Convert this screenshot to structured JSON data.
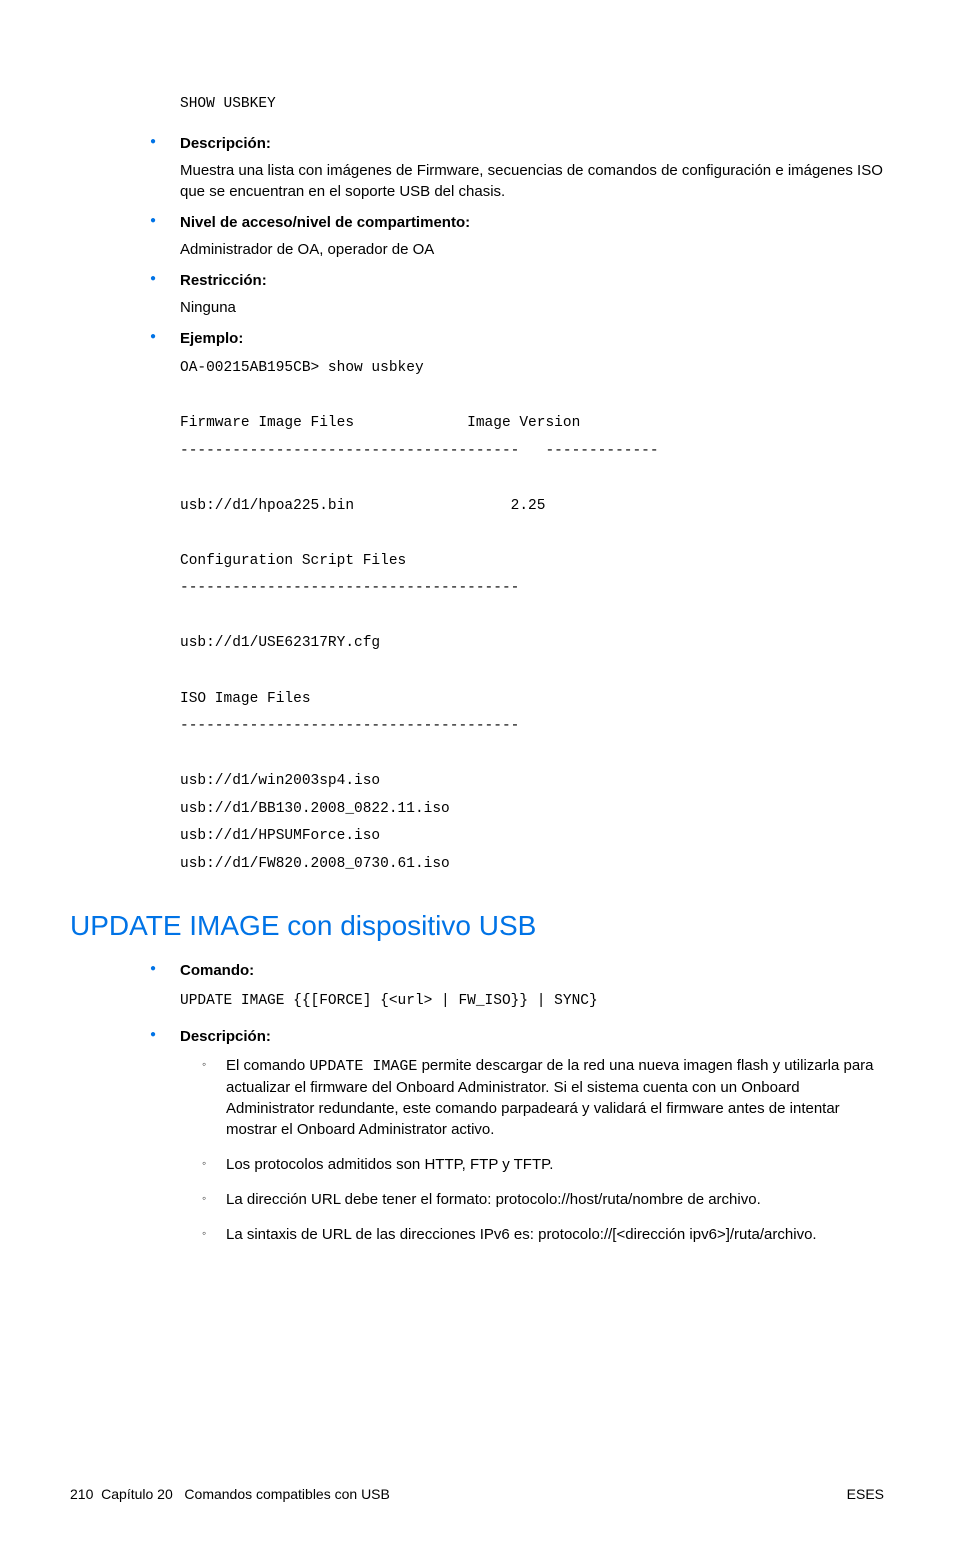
{
  "cmd_block": "SHOW USBKEY",
  "items": [
    {
      "label": "Descripción:",
      "body": "Muestra una lista con imágenes de Firmware, secuencias de comandos de configuración e imágenes ISO que se encuentran en el soporte USB del chasis."
    },
    {
      "label": "Nivel de acceso/nivel de compartimento:",
      "body": "Administrador de OA, operador de OA"
    },
    {
      "label": "Restricción:",
      "body": "Ninguna"
    },
    {
      "label": "Ejemplo:"
    }
  ],
  "example_output": "OA-00215AB195CB> show usbkey\n\nFirmware Image Files             Image Version\n---------------------------------------   -------------\n\nusb://d1/hpoa225.bin                  2.25\n\nConfiguration Script Files\n---------------------------------------\n\nusb://d1/USE62317RY.cfg\n\nISO Image Files\n---------------------------------------\n\nusb://d1/win2003sp4.iso\nusb://d1/BB130.2008_0822.11.iso\nusb://d1/HPSUMForce.iso\nusb://d1/FW820.2008_0730.61.iso",
  "section_heading": "UPDATE IMAGE con dispositivo USB",
  "update": {
    "comando_label": "Comando:",
    "comando_code": "UPDATE IMAGE {{[FORCE] {<url> | FW_ISO}} | SYNC}",
    "descripcion_label": "Descripción:",
    "sub": [
      {
        "pre": "El comando ",
        "code": "UPDATE IMAGE",
        "post": " permite descargar de la red una nueva imagen flash y utilizarla para actualizar el firmware del Onboard Administrator. Si el sistema cuenta con un Onboard Administrator redundante, este comando parpadeará y validará el firmware antes de intentar mostrar el Onboard Administrator activo."
      },
      {
        "text": "Los protocolos admitidos son HTTP, FTP y TFTP."
      },
      {
        "text": "La dirección URL debe tener el formato: protocolo://host/ruta/nombre de archivo."
      },
      {
        "text": "La sintaxis de URL de las direcciones IPv6 es: protocolo://[<dirección ipv6>]/ruta/archivo."
      }
    ]
  },
  "footer": {
    "page": "210",
    "chapter": "Capítulo 20",
    "title": "Comandos compatibles con USB",
    "right": "ESES"
  }
}
